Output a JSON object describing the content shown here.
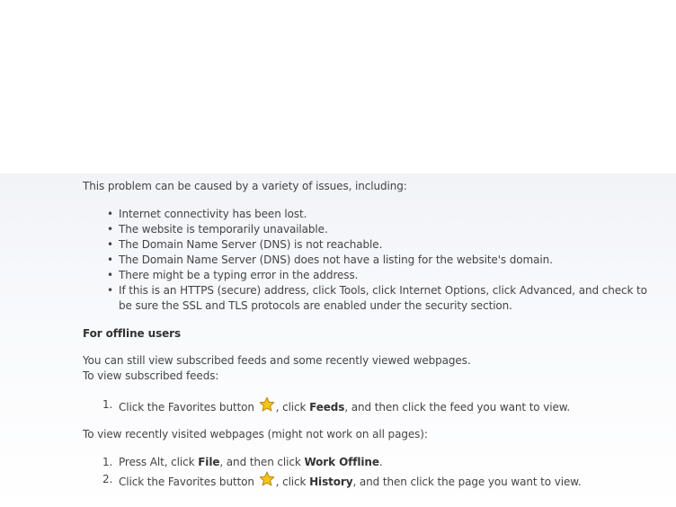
{
  "intro": "This problem can be caused by a variety of issues, including:",
  "issues": [
    "Internet connectivity has been lost.",
    "The website is temporarily unavailable.",
    "The Domain Name Server (DNS) is not reachable.",
    "The Domain Name Server (DNS) does not have a listing for the website's domain.",
    "There might be a typing error in the address.",
    "If this is an HTTPS (secure) address, click Tools, click Internet Options, click Advanced, and check to be sure the SSL and TLS protocols are enabled under the security section."
  ],
  "offline": {
    "heading": "For offline users",
    "line1": "You can still view subscribed feeds and some recently viewed webpages.",
    "line2": "To view subscribed feeds:",
    "feed_steps": [
      {
        "num": "1.",
        "pre": "Click the Favorites button",
        "mid": ", click ",
        "bold": "Feeds",
        "post": ", and then click the feed you want to view."
      }
    ],
    "recent_intro": "To view recently visited webpages (might not work on all pages):",
    "recent_steps": [
      {
        "num": "1.",
        "pre": "Press Alt, click ",
        "bold1": "File",
        "mid": ", and then click ",
        "bold2": "Work Offline",
        "post": "."
      },
      {
        "num": "2.",
        "pre": "Click the Favorites button",
        "mid": ", click ",
        "bold": "History",
        "post": ", and then click the page you want to view."
      }
    ]
  },
  "icons": {
    "favorites": "star-icon",
    "star_fill": "#f5c518",
    "star_stroke": "#b8860b"
  }
}
